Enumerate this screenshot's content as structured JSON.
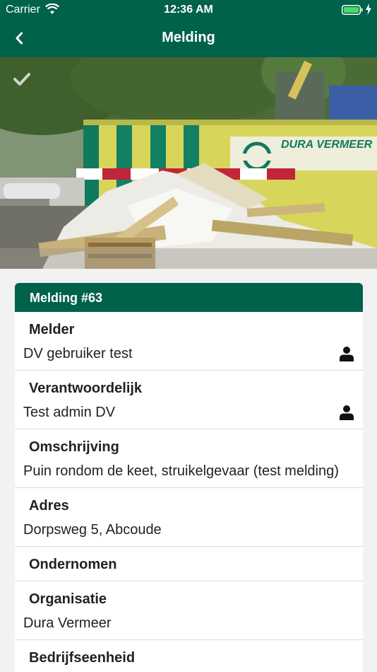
{
  "status": {
    "carrier": "Carrier",
    "time": "12:36 AM"
  },
  "nav": {
    "title": "Melding"
  },
  "photo": {
    "sign_text": "DURA VERMEER"
  },
  "card": {
    "title": "Melding #63"
  },
  "rows": [
    {
      "label": "Melder",
      "value": "DV gebruiker test",
      "icon": "person-icon"
    },
    {
      "label": "Verantwoordelijk",
      "value": "Test admin DV",
      "icon": "person-icon"
    },
    {
      "label": "Omschrijving",
      "value": "Puin rondom de keet, struikelgevaar (test melding)"
    },
    {
      "label": "Adres",
      "value": "Dorpsweg 5, Abcoude"
    },
    {
      "label": "Ondernomen",
      "value": ""
    },
    {
      "label": "Organisatie",
      "value": "Dura Vermeer"
    },
    {
      "label": "Bedrijfseenheid",
      "value": ""
    }
  ],
  "colors": {
    "brand_green": "#00624a",
    "background": "#f2f2f2"
  }
}
